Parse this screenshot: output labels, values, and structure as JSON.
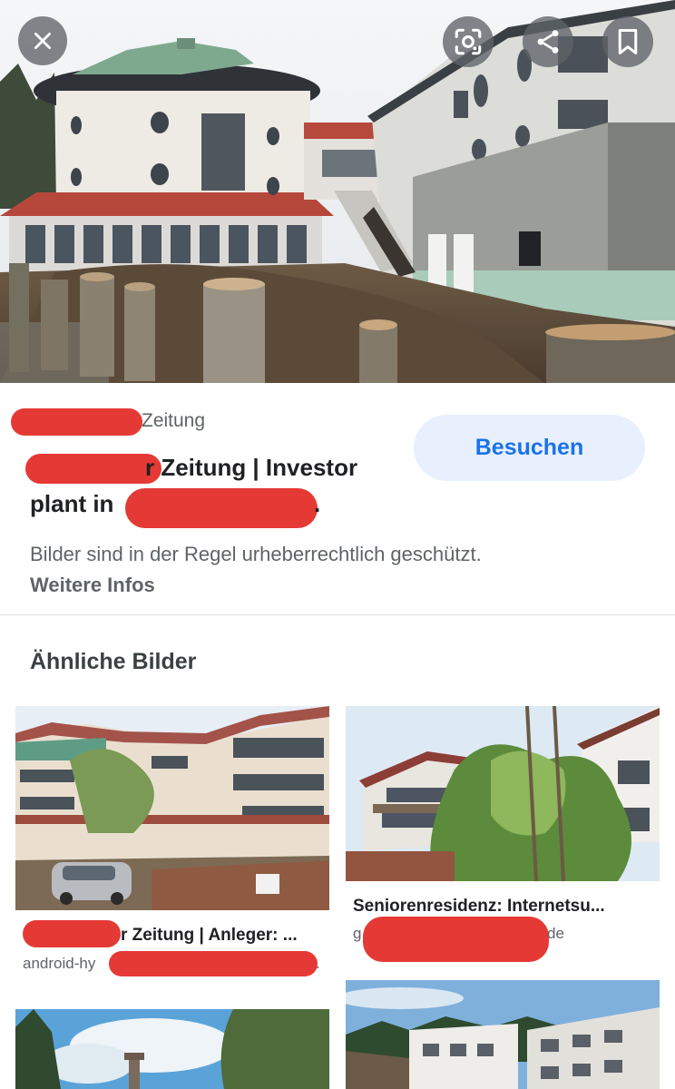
{
  "viewer": {
    "close_icon": "close-icon",
    "lens_icon": "google-lens-icon",
    "share_icon": "share-icon",
    "bookmark_icon": "bookmark-icon"
  },
  "result": {
    "source_suffix": "Zeitung",
    "title_line1": "r Zeitung | Investor",
    "title_line2": "plant in",
    "title_end": ".",
    "visit_label": "Besuchen",
    "copyright_text": "Bilder sind in der Regel urheberrechtlich geschützt.",
    "more_info_label": "Weitere Infos"
  },
  "similar": {
    "heading": "Ähnliche Bilder",
    "cards": [
      {
        "title": "r Zeitung | Anleger: ...",
        "domain": "android-hy",
        "domain_end": "."
      },
      {
        "title": "Seniorenresidenz: Internetsu...",
        "domain": "g",
        "domain_end": "de"
      }
    ]
  },
  "colors": {
    "accent": "#1a73e8",
    "visit_bg": "#e8f0fe",
    "redaction": "#e53935"
  }
}
